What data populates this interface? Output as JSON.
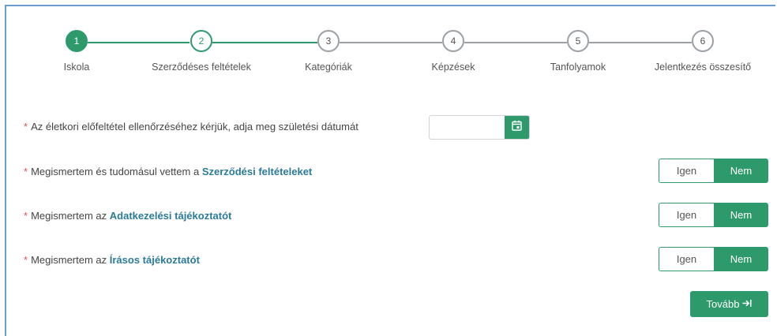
{
  "stepper": {
    "steps": [
      {
        "number": "1",
        "label": "Iskola",
        "state": "done"
      },
      {
        "number": "2",
        "label": "Szerződéses feltételek",
        "state": "active"
      },
      {
        "number": "3",
        "label": "Kategóriák",
        "state": "todo"
      },
      {
        "number": "4",
        "label": "Képzések",
        "state": "todo"
      },
      {
        "number": "5",
        "label": "Tanfolyamok",
        "state": "todo"
      },
      {
        "number": "6",
        "label": "Jelentkezés összesítő",
        "state": "todo"
      }
    ]
  },
  "form": {
    "required_mark": "*",
    "birthdate": {
      "label": "Az életkori előfeltétel ellenőrzéséhez kérjük, adja meg születési dátumát",
      "value": "",
      "calendar_icon": "calendar-icon"
    },
    "terms": {
      "label_prefix": "Megismertem és tudomásul vettem a ",
      "link_text": "Szerződési feltételeket",
      "yes_label": "Igen",
      "no_label": "Nem",
      "selected": "Nem"
    },
    "privacy": {
      "label_prefix": "Megismertem az ",
      "link_text": "Adatkezelési tájékoztatót",
      "yes_label": "Igen",
      "no_label": "Nem",
      "selected": "Nem"
    },
    "written_info": {
      "label_prefix": "Megismertem az ",
      "link_text": "Írásos tájékoztatót",
      "yes_label": "Igen",
      "no_label": "Nem",
      "selected": "Nem"
    }
  },
  "actions": {
    "next_label": "Tovább",
    "next_icon": "arrow-right-to-bar-icon"
  },
  "colors": {
    "accent": "#2e9a6c",
    "link": "#2b7a9a",
    "required": "#d9534f",
    "inactive_step": "#9aa0a6"
  }
}
